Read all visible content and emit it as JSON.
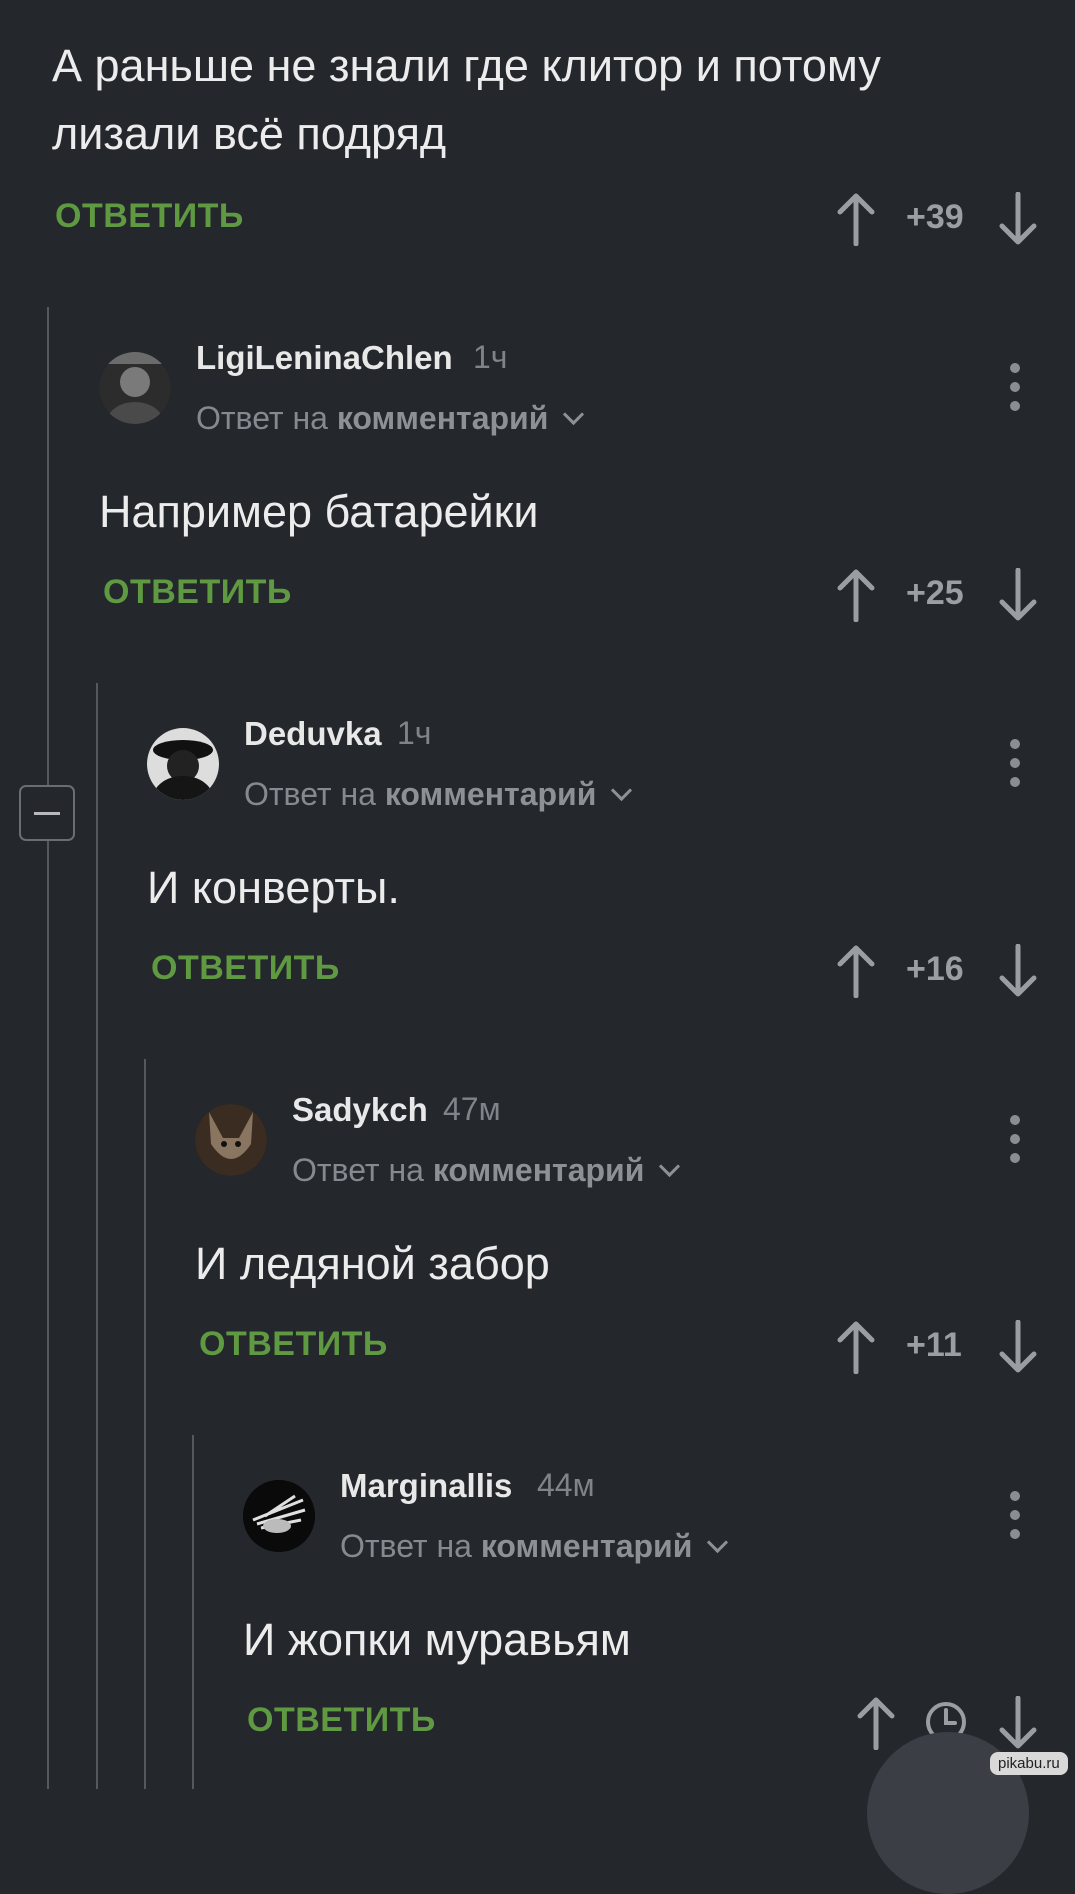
{
  "root_comment": {
    "text": "А раньше не знали где клитор и потому лизали всё подряд",
    "reply_label": "ОТВЕТИТЬ",
    "rating": "+39"
  },
  "comments": [
    {
      "author": "LigiLeninaChlen",
      "time": "1ч",
      "reply_prefix": "Ответ на",
      "reply_link": "комментарий",
      "text": "Например батарейки",
      "reply_label": "ОТВЕТИТЬ",
      "rating": "+25"
    },
    {
      "author": "Deduvka",
      "time": "1ч",
      "reply_prefix": "Ответ на",
      "reply_link": "комментарий",
      "text": "И конверты.",
      "reply_label": "ОТВЕТИТЬ",
      "rating": "+16"
    },
    {
      "author": "Sadykch",
      "time": "47м",
      "reply_prefix": "Ответ на",
      "reply_link": "комментарий",
      "text": "И ледяной забор",
      "reply_label": "ОТВЕТИТЬ",
      "rating": "+11"
    },
    {
      "author": "Marginallis",
      "time": "44м",
      "reply_prefix": "Ответ на",
      "reply_link": "комментарий",
      "text": "И жопки муравьям",
      "reply_label": "ОТВЕТИТЬ",
      "rating": ""
    }
  ],
  "watermark": "pikabu.ru",
  "colors": {
    "background": "#24272c",
    "reply_green": "#5f9a42",
    "muted": "#868a90"
  },
  "icons": [
    "upvote-arrow-icon",
    "downvote-arrow-icon",
    "kebab-menu-icon",
    "clock-icon",
    "collapse-minus-icon",
    "chevron-down-icon"
  ]
}
